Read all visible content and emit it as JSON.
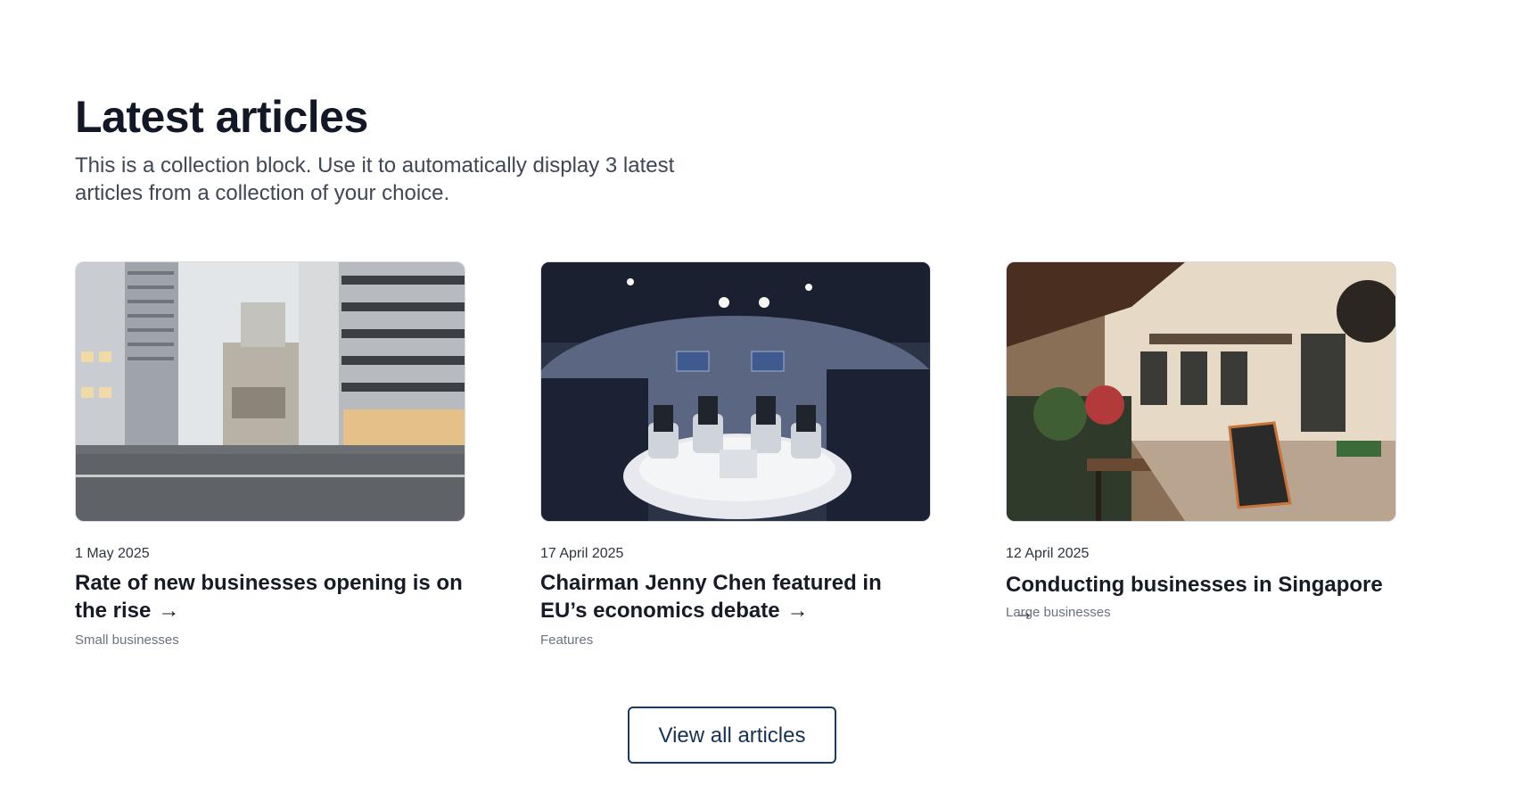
{
  "section": {
    "heading": "Latest articles",
    "intro": "This is a collection block. Use it to automatically display 3 latest articles from a collection of your choice."
  },
  "articles": [
    {
      "date": "1 May 2025",
      "title": "Rate of new businesses opening is on the rise",
      "category": "Small businesses",
      "image_alt": "street-scene-photo"
    },
    {
      "date": "17 April 2025",
      "title": "Chairman Jenny Chen featured in EU’s economics debate",
      "category": "Features",
      "image_alt": "panel-debate-photo"
    },
    {
      "date": "12 April 2025",
      "title": "Conducting businesses in Singapore",
      "category": "Large businesses",
      "image_alt": "cafe-terrace-photo"
    }
  ],
  "view_all_label": "View all articles",
  "icons": {
    "title_arrow": "arrow-right-icon"
  },
  "colors": {
    "text": "#161b26",
    "muted": "#6b7280",
    "button_border": "#1e3a5f"
  }
}
